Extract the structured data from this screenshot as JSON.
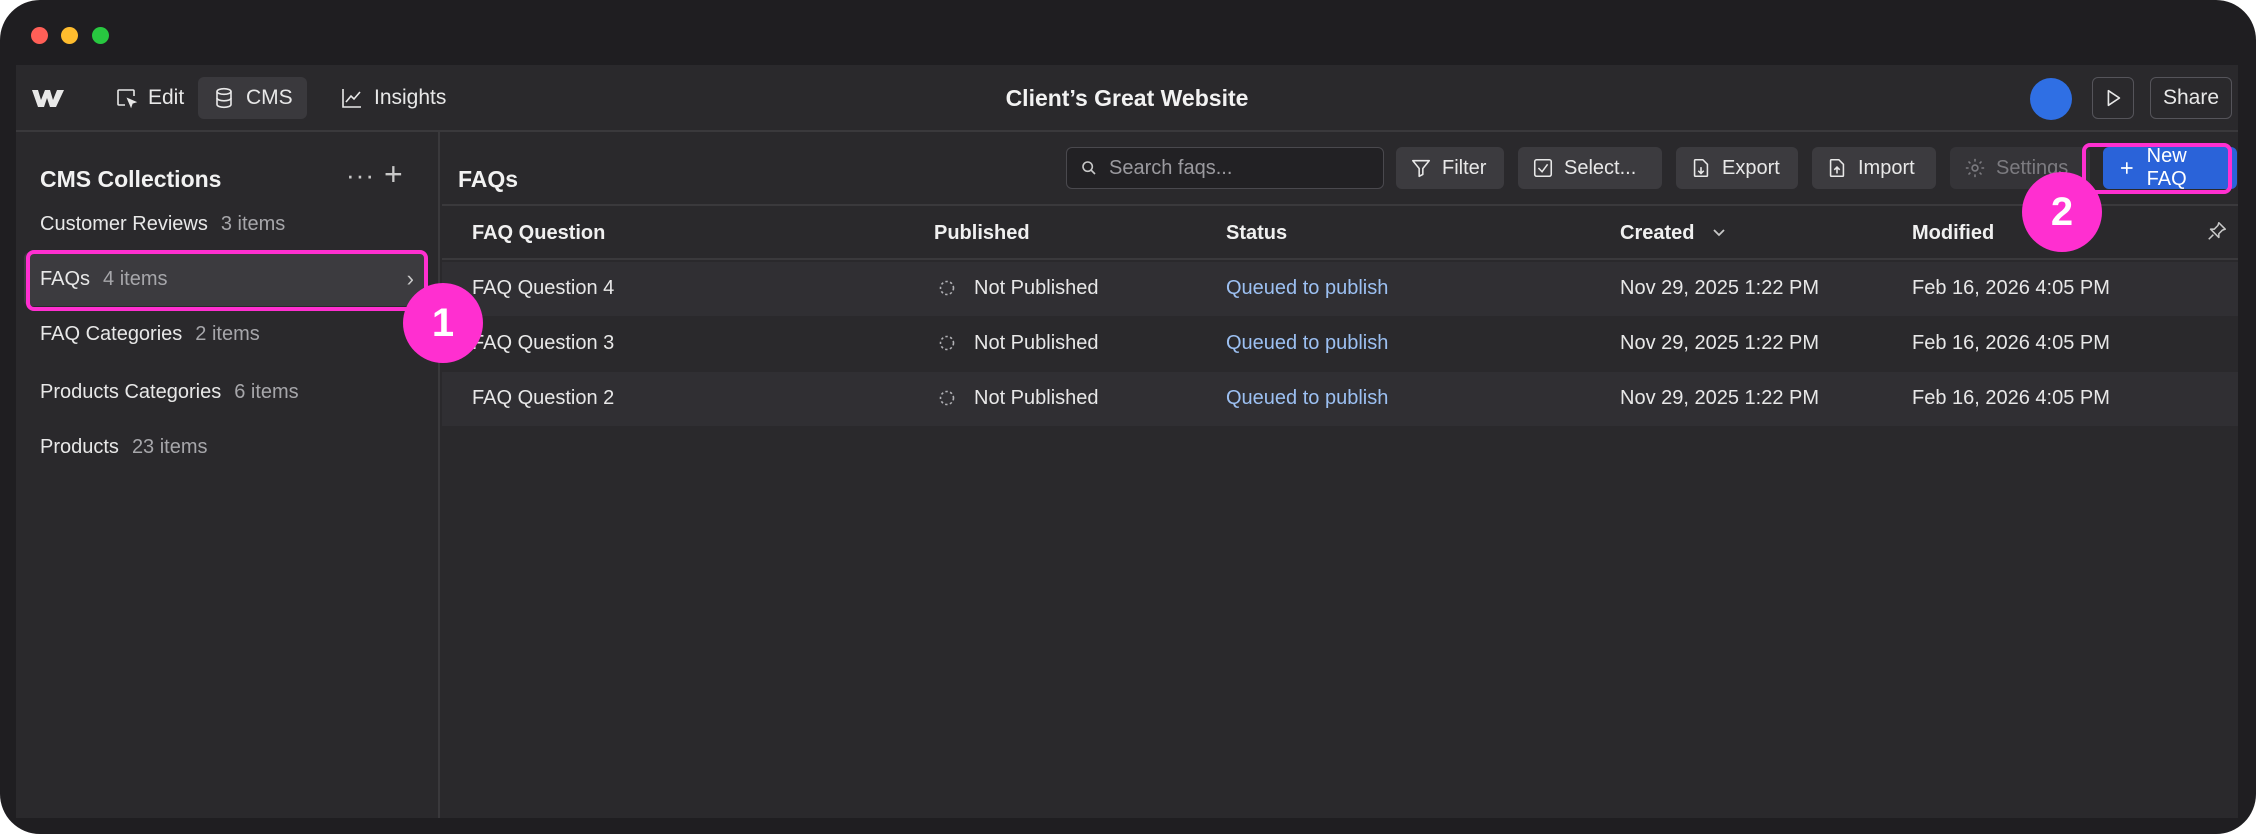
{
  "topbar": {
    "nav": [
      {
        "label": "Edit",
        "icon": "cursor-box-icon"
      },
      {
        "label": "CMS",
        "icon": "database-icon"
      },
      {
        "label": "Insights",
        "icon": "chart-icon"
      }
    ],
    "site_title": "Client’s Great Website",
    "share_label": "Share",
    "avatar_color": "#2f6fe4"
  },
  "sidebar": {
    "title": "CMS Collections",
    "more_label": "···",
    "add_label": "+",
    "collections": [
      {
        "name": "Customer Reviews",
        "count": "3 items"
      },
      {
        "name": "FAQs",
        "count": "4 items"
      },
      {
        "name": "FAQ Categories",
        "count": "2 items"
      },
      {
        "name": "Products Categories",
        "count": "6 items"
      },
      {
        "name": "Products",
        "count": "23 items"
      }
    ]
  },
  "main": {
    "title": "FAQs",
    "search_placeholder": "Search faqs...",
    "toolbar": {
      "filter": "Filter",
      "select": "Select...",
      "export": "Export",
      "import": "Import",
      "settings": "Settings",
      "new": "New FAQ"
    },
    "columns": [
      "FAQ Question",
      "Published",
      "Status",
      "Created",
      "Modified"
    ],
    "rows": [
      {
        "question": "FAQ Question 4",
        "published": "Not Published",
        "status": "Queued to publish",
        "created": "Nov 29, 2025 1:22 PM",
        "modified": "Feb 16, 2026 4:05 PM"
      },
      {
        "question": "FAQ Question 3",
        "published": "Not Published",
        "status": "Queued to publish",
        "created": "Nov 29, 2025 1:22 PM",
        "modified": "Feb 16, 2026 4:05 PM"
      },
      {
        "question": "FAQ Question 2",
        "published": "Not Published",
        "status": "Queued to publish",
        "created": "Nov 29, 2025 1:22 PM",
        "modified": "Feb 16, 2026 4:05 PM"
      }
    ]
  },
  "annotations": {
    "step1": "1",
    "step2": "2",
    "color": "#ff2fd0"
  },
  "colors": {
    "accent": "#2a63d9",
    "status_link": "#9cc0f2"
  }
}
